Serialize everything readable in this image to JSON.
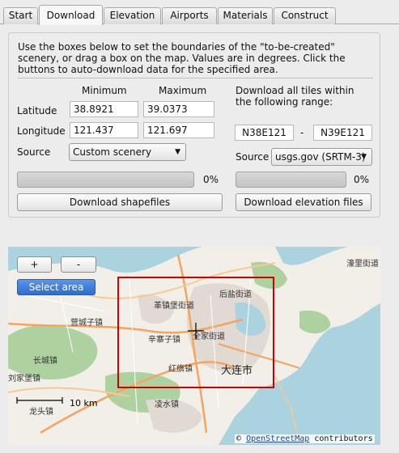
{
  "tabs": [
    {
      "label": "Start",
      "active": false
    },
    {
      "label": "Download",
      "active": true
    },
    {
      "label": "Elevation",
      "active": false
    },
    {
      "label": "Airports",
      "active": false
    },
    {
      "label": "Materials",
      "active": false
    },
    {
      "label": "Construct",
      "active": false
    }
  ],
  "download": {
    "description": "Use the boxes below to set the boundaries of the \"to-be-created\" scenery, or drag a box on the map. Values are in degrees. Click the buttons to auto-download data for the specified area.",
    "minimum_label": "Minimum",
    "maximum_label": "Maximum",
    "latitude_label": "Latitude",
    "longitude_label": "Longitude",
    "lat_min": "38.8921",
    "lat_max": "39.0373",
    "lon_min": "121.437",
    "lon_max": "121.697",
    "source_label": "Source",
    "source_value": "Custom scenery",
    "progress_percent": 0,
    "progress_label": "0%",
    "download_shapefiles_label": "Download shapefiles",
    "tiles_label": "Download all tiles within the following range:",
    "tile_from": "N38E121",
    "tile_dash": "-",
    "tile_to": "N39E121",
    "elev_source_label": "Source",
    "elev_source_value": "usgs.gov (SRTM-3)",
    "elev_progress_percent": 0,
    "elev_progress_label": "0%",
    "download_elevation_label": "Download elevation files"
  },
  "map": {
    "zoom_in_label": "+",
    "zoom_out_label": "-",
    "select_area_label": "Select area",
    "scale_label": "10 km",
    "labels": {
      "haozuizi": "濠里街道",
      "houyan": "后盐街道",
      "gezhenbao": "革镇堡街道",
      "yingchengzi": "营城子镇",
      "xinzhaizi": "辛寨子镇",
      "quanjie": "全家街道",
      "changcheng": "长城镇",
      "hongqi": "红旗镇",
      "dalian": "大连市",
      "shuiwang": "刘家堡镇",
      "longwang": "龙头镇",
      "lingshui": "凌水镇"
    },
    "attribution_prefix": "©",
    "attribution_link": "OpenStreetMap",
    "attribution_suffix": "contributors"
  },
  "colors": {
    "selection_box": "#d40000",
    "sea": "#aad3df",
    "land": "#f2efe9",
    "urban": "#e0dad3",
    "forest": "#aed1a0",
    "road_major": "#f7a35c"
  }
}
